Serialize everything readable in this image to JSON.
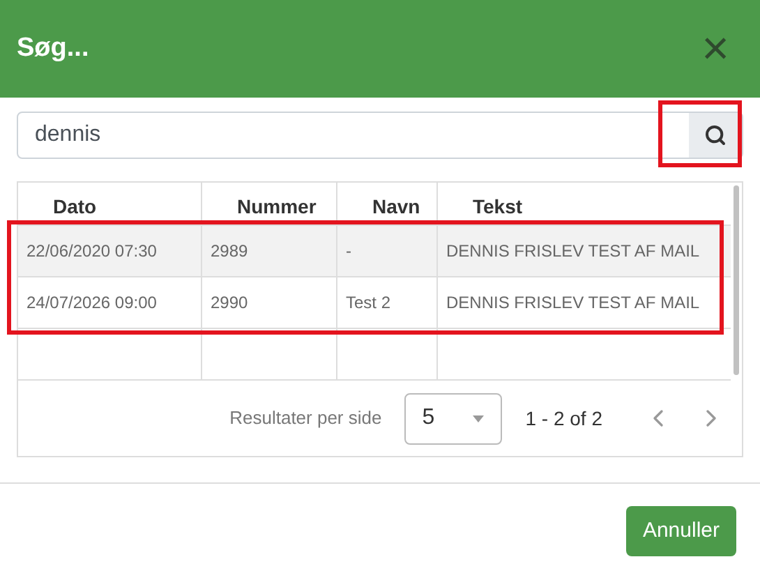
{
  "dialog": {
    "title": "Søg...",
    "close": "×"
  },
  "search": {
    "value": "dennis",
    "highlighted": true
  },
  "table": {
    "columns": [
      "Dato",
      "Nummer",
      "Navn",
      "Tekst"
    ],
    "rows": [
      {
        "cells": [
          "22/06/2020 07:30",
          "2989",
          "-",
          "DENNIS FRISLEV TEST AF MAIL"
        ],
        "selected": true
      },
      {
        "cells": [
          "24/07/2026 09:00",
          "2990",
          "Test 2",
          "DENNIS FRISLEV TEST AF MAIL"
        ],
        "selected": false
      }
    ],
    "rows_highlighted": true
  },
  "pagination": {
    "label": "Resultater per side",
    "page_size": "5",
    "range": "1 - 2 of 2",
    "previous_disabled": true,
    "next_disabled": true
  },
  "buttons": [
    "Annuller"
  ]
}
